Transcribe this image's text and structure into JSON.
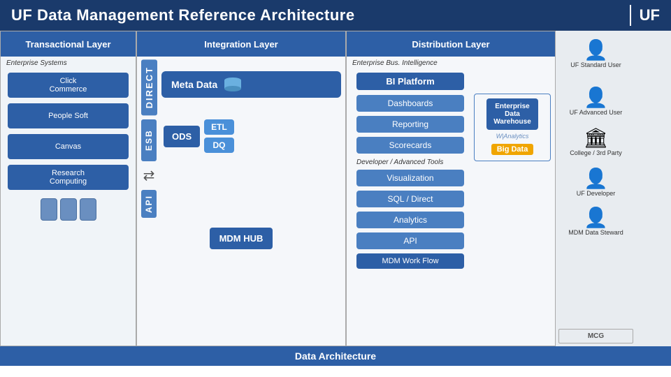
{
  "header": {
    "title": "UF Data Management Reference Architecture",
    "logo_divider": "|",
    "logo_text": "UF"
  },
  "transactional_layer": {
    "label": "Transactional Layer",
    "enterprise_systems": "Enterprise Systems",
    "systems": [
      {
        "id": "click-commerce",
        "label": "Click Commerce"
      },
      {
        "id": "people-soft",
        "label": "People Soft"
      },
      {
        "id": "canvas",
        "label": "Canvas"
      },
      {
        "id": "research-computing",
        "label": "Research Computing"
      }
    ]
  },
  "integration_layer": {
    "label": "Integration Layer",
    "direct_label": "DIRECT",
    "esb_label": "ESB",
    "api_label": "API",
    "meta_data_label": "Meta Data",
    "ods_label": "ODS",
    "etl_label": "ETL",
    "dq_label": "DQ",
    "mdm_hub_label": "MDM HUB"
  },
  "distribution_layer": {
    "label": "Distribution Layer",
    "enterprise_bi": "Enterprise Bus. Intelligence",
    "bi_platform": "BI Platform",
    "dashboards": "Dashboards",
    "reporting": "Reporting",
    "scorecards": "Scorecards",
    "dev_tools": "Developer / Advanced Tools",
    "visualization": "Visualization",
    "sql_direct": "SQL / Direct",
    "analytics": "Analytics",
    "api": "API",
    "enterprise_data": "Enterprise Data Warehouse",
    "big_data": "Big Data",
    "mdm_workflow": "MDM Work Flow"
  },
  "users": {
    "standard_user": "UF Standard User",
    "advanced_user": "UF Advanced User",
    "developer": "UF Developer",
    "data_steward": "MDM Data Steward",
    "college": "College / 3rd Party"
  },
  "footer": {
    "label": "Data Architecture"
  }
}
